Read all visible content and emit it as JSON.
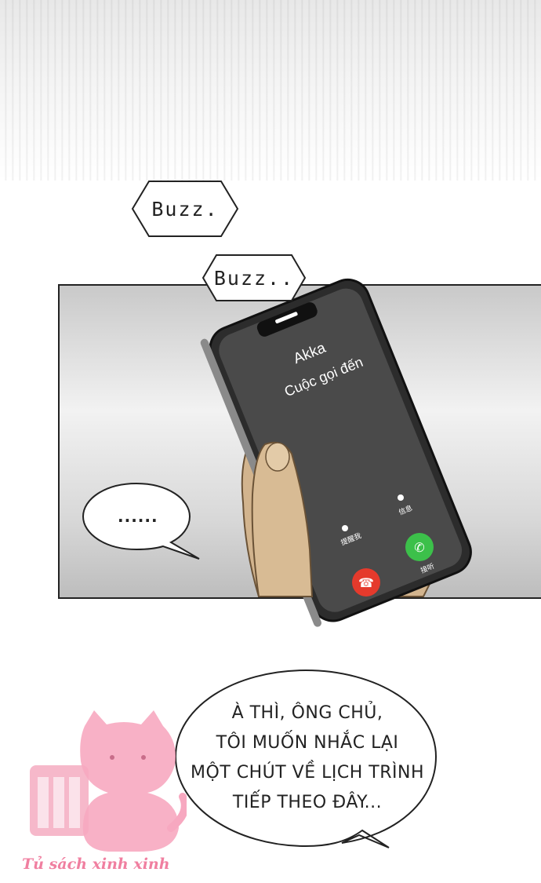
{
  "sfx": {
    "buzz1": "Buzz.",
    "buzz2": "Buzz.."
  },
  "phone": {
    "caller": "Akka",
    "status": "Cuộc gọi đến",
    "msg_label": "信息",
    "remind_label": "提醒我",
    "accept_label": "接听"
  },
  "bubbles": {
    "silence": "......",
    "speech_line1": "À THÌ, ÔNG CHỦ,",
    "speech_line2": "TÔI MUỐN NHẮC LẠI",
    "speech_line3": "MỘT CHÚT VỀ LỊCH TRÌNH",
    "speech_line4": "TIẾP THEO ĐÂY..."
  },
  "watermark": {
    "text": "Tủ sách xinh xinh"
  },
  "colors": {
    "decline": "#e53a2c",
    "accept": "#3cc04a",
    "screen": "#4a4a4a",
    "watermark": "#f07fa0"
  }
}
